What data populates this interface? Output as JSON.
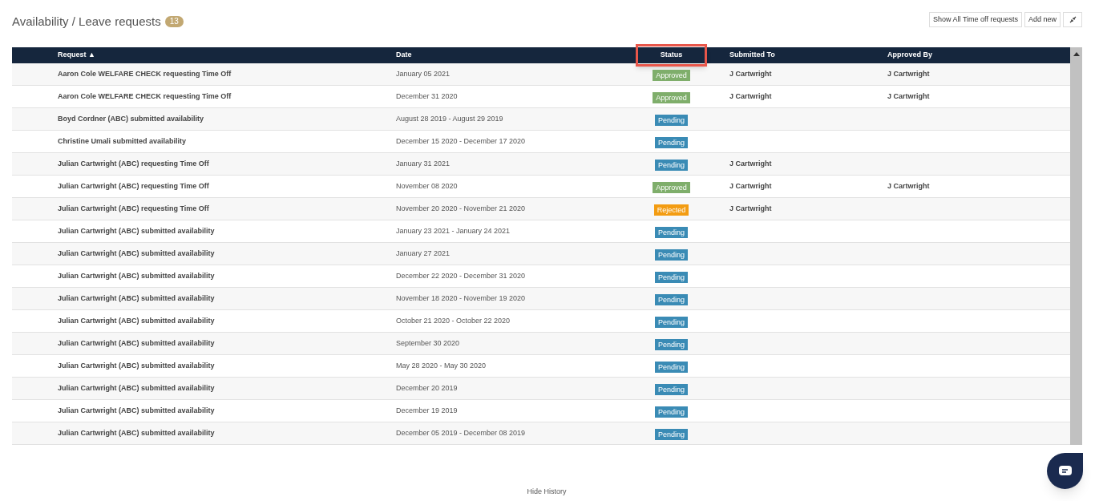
{
  "title": "Availability / Leave requests",
  "count": "13",
  "actions": [
    {
      "kind": "text",
      "label": "Show All Time off requests"
    },
    {
      "kind": "text",
      "label": "Add new"
    },
    {
      "kind": "collapse"
    }
  ],
  "columns": [
    {
      "label": "Request ▲",
      "highlighted": false
    },
    {
      "label": "Date",
      "highlighted": false
    },
    {
      "label": "Status",
      "highlighted": true
    },
    {
      "label": "Submitted To",
      "highlighted": false
    },
    {
      "label": "Approved By",
      "highlighted": false
    }
  ],
  "rows": [
    {
      "request": "Aaron Cole WELFARE CHECK requesting Time Off",
      "date": "January 05 2021",
      "status": {
        "kind": "approved",
        "label": "Approved"
      },
      "submitted_to": "J Cartwright",
      "approved_by": "J Cartwright"
    },
    {
      "request": "Aaron Cole WELFARE CHECK requesting Time Off",
      "date": "December 31 2020",
      "status": {
        "kind": "approved",
        "label": "Approved"
      },
      "submitted_to": "J Cartwright",
      "approved_by": "J Cartwright"
    },
    {
      "request": "Boyd Cordner (ABC) submitted availability",
      "date": "August 28 2019 - August 29 2019",
      "status": {
        "kind": "pending",
        "label": "Pending"
      }
    },
    {
      "request": "Christine Umali submitted availability",
      "date": "December 15 2020 - December 17 2020",
      "status": {
        "kind": "pending",
        "label": "Pending"
      }
    },
    {
      "request": "Julian Cartwright (ABC) requesting Time Off",
      "date": "January 31 2021",
      "status": {
        "kind": "pending",
        "label": "Pending"
      },
      "submitted_to": "J Cartwright"
    },
    {
      "request": "Julian Cartwright (ABC) requesting Time Off",
      "date": "November 08 2020",
      "status": {
        "kind": "approved",
        "label": "Approved"
      },
      "submitted_to": "J Cartwright",
      "approved_by": "J Cartwright"
    },
    {
      "request": "Julian Cartwright (ABC) requesting Time Off",
      "date": "November 20 2020 - November 21 2020",
      "status": {
        "kind": "rejected",
        "label": "Rejected"
      },
      "submitted_to": "J Cartwright"
    },
    {
      "request": "Julian Cartwright (ABC) submitted availability",
      "date": "January 23 2021 - January 24 2021",
      "status": {
        "kind": "pending",
        "label": "Pending"
      }
    },
    {
      "request": "Julian Cartwright (ABC) submitted availability",
      "date": "January 27 2021",
      "status": {
        "kind": "pending",
        "label": "Pending"
      }
    },
    {
      "request": "Julian Cartwright (ABC) submitted availability",
      "date": "December 22 2020 - December 31 2020",
      "status": {
        "kind": "pending",
        "label": "Pending"
      }
    },
    {
      "request": "Julian Cartwright (ABC) submitted availability",
      "date": "November 18 2020 - November 19 2020",
      "status": {
        "kind": "pending",
        "label": "Pending"
      }
    },
    {
      "request": "Julian Cartwright (ABC) submitted availability",
      "date": "October 21 2020 - October 22 2020",
      "status": {
        "kind": "pending",
        "label": "Pending"
      }
    },
    {
      "request": "Julian Cartwright (ABC) submitted availability",
      "date": "September 30 2020",
      "status": {
        "kind": "pending",
        "label": "Pending"
      }
    },
    {
      "request": "Julian Cartwright (ABC) submitted availability",
      "date": "May 28 2020 - May 30 2020",
      "status": {
        "kind": "pending",
        "label": "Pending"
      }
    },
    {
      "request": "Julian Cartwright (ABC) submitted availability",
      "date": "December 20 2019",
      "status": {
        "kind": "pending",
        "label": "Pending"
      }
    },
    {
      "request": "Julian Cartwright (ABC) submitted availability",
      "date": "December 19 2019",
      "status": {
        "kind": "pending",
        "label": "Pending"
      }
    },
    {
      "request": "Julian Cartwright (ABC) submitted availability",
      "date": "December 05 2019 - December 08 2019",
      "status": {
        "kind": "pending",
        "label": "Pending"
      }
    }
  ],
  "footer_link": "Hide History"
}
